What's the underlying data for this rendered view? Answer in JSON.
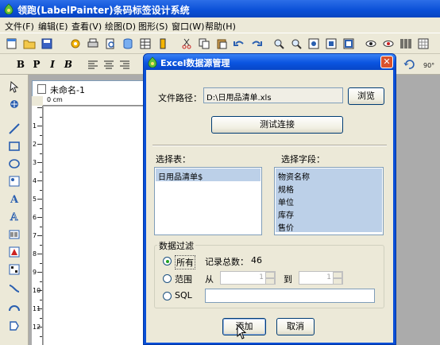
{
  "app": {
    "title": "领跑(LabelPainter)条码标签设计系统"
  },
  "menu": [
    {
      "label": "文件(F)"
    },
    {
      "label": "编辑(E)"
    },
    {
      "label": "查看(V)"
    },
    {
      "label": "绘图(D)"
    },
    {
      "label": "图形(S)"
    },
    {
      "label": "窗口(W)"
    },
    {
      "label": "帮助(H)"
    }
  ],
  "format_toolbar": {
    "bold": "B",
    "bold_outline": "P",
    "italic": "I",
    "bold_italic": "B"
  },
  "document": {
    "tab_label": "未命名-1",
    "ruler_unit": "cm",
    "ruler_h_marks": [
      "0"
    ],
    "ruler_v_marks": [
      "1",
      "2",
      "3",
      "4",
      "5",
      "6",
      "7",
      "8",
      "9",
      "10",
      "11",
      "12"
    ]
  },
  "dialog": {
    "title": "Excel数据源管理",
    "file_path_label": "文件路径：",
    "file_path_value": "D:\\日用品清单.xls",
    "browse_label": "浏览",
    "test_connection_label": "测试连接",
    "tables_label": "选择表：",
    "tables": [
      "日用品清单$"
    ],
    "fields_label": "选择字段：",
    "fields": [
      "物资名称",
      "规格",
      "单位",
      "库存",
      "售价"
    ],
    "filter_group_label": "数据过滤",
    "filter_all_label": "所有",
    "record_count_label": "记录总数：",
    "record_count_value": "46",
    "filter_range_label": "范围",
    "range_from_label": "从",
    "range_from_value": "1",
    "range_to_label": "到",
    "range_to_value": "1",
    "filter_sql_label": "SQL",
    "sql_value": "",
    "add_label": "添加",
    "cancel_label": "取消",
    "close_glyph": "✕"
  },
  "colors": {
    "titlebar": "#0a4fd6",
    "selection": "#bcd0e8",
    "radio_dot": "#21a121"
  }
}
